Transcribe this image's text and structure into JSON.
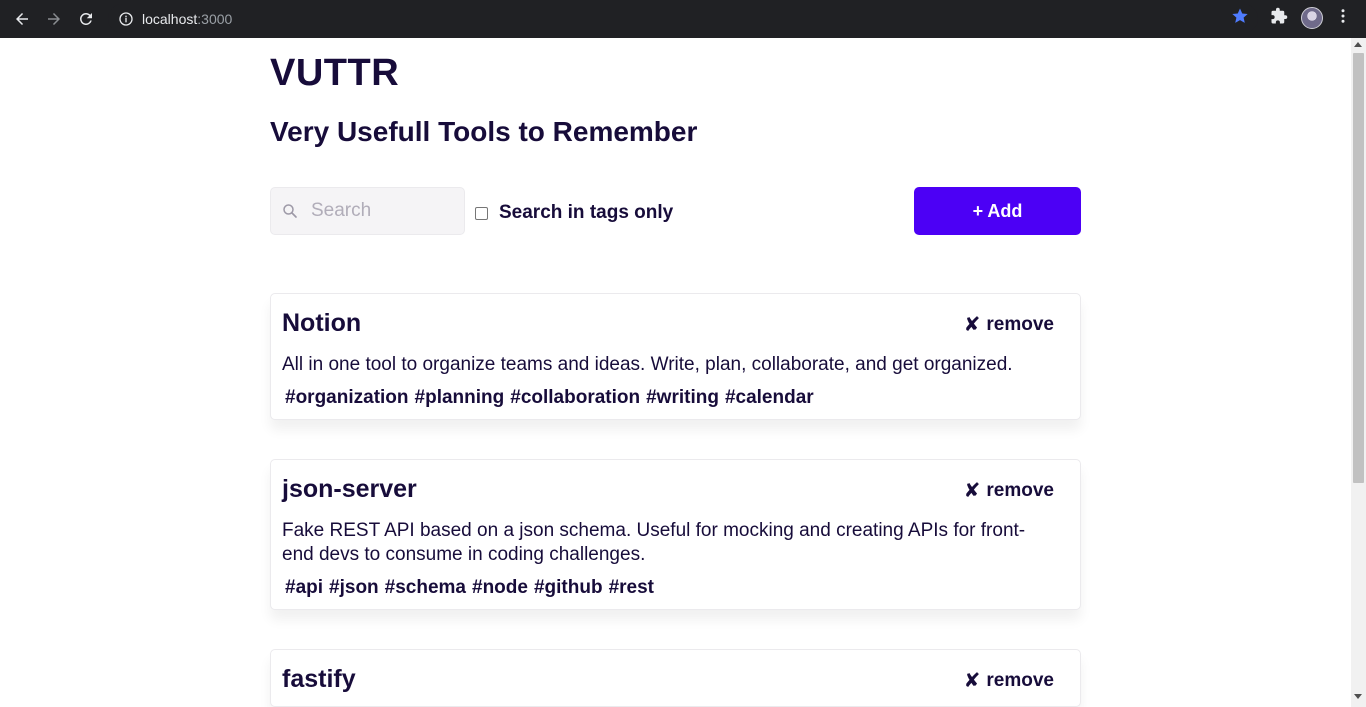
{
  "browser": {
    "url_host": "localhost",
    "url_port": ":3000"
  },
  "app": {
    "title": "VUTTR",
    "subtitle": "Very Usefull Tools to Remember"
  },
  "toolbar": {
    "search_placeholder": "Search",
    "search_value": "",
    "tags_only_label": "Search in tags only",
    "tags_only_checked": false,
    "add_label": "+ Add",
    "accent_color": "#4c00f5"
  },
  "tools": [
    {
      "name": "Notion",
      "remove_label": "remove",
      "remove_icon": "✘",
      "description": "All in one tool to organize teams and ideas. Write, plan, collaborate, and get organized.",
      "tags": [
        "#organization",
        "#planning",
        "#collaboration",
        "#writing",
        "#calendar"
      ]
    },
    {
      "name": "json-server",
      "remove_label": "remove",
      "remove_icon": "✘",
      "description": "Fake REST API based on a json schema. Useful for mocking and creating APIs for front-end devs to consume in coding challenges.",
      "tags": [
        "#api",
        "#json",
        "#schema",
        "#node",
        "#github",
        "#rest"
      ]
    },
    {
      "name": "fastify",
      "remove_label": "remove",
      "remove_icon": "✘"
    }
  ]
}
